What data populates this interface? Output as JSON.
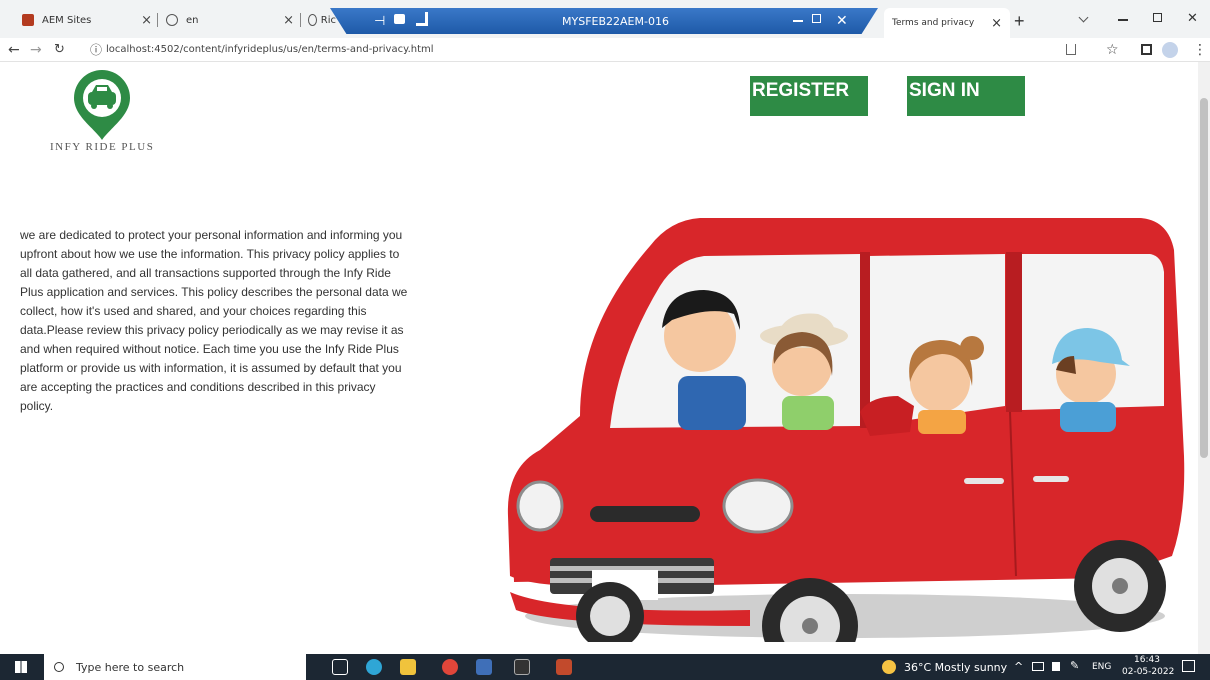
{
  "browser": {
    "tabs": [
      {
        "label": "AEM Sites"
      },
      {
        "label": "en"
      },
      {
        "label": "Ric"
      }
    ],
    "active_tab": {
      "label": "Terms and privacy"
    },
    "close_glyph": "×",
    "new_tab_glyph": "+",
    "remote_session": {
      "title": "MYSFEB22AEM-016"
    },
    "address": {
      "info_glyph": "ⓘ",
      "url": "localhost:4502/content/infyrideplus/us/en/terms-and-privacy.html"
    }
  },
  "header": {
    "register_label": "REGISTER",
    "signin_label": "SIGN IN",
    "logo_text": "INFY RIDE PLUS"
  },
  "policy_text": "we are dedicated to protect your personal information and informing you upfront about how we use the information. This privacy policy applies to all data gathered, and all transactions supported through the Infy Ride Plus application and services. This policy describes the personal data we collect, how it's used and shared, and your choices regarding this data.Please review this privacy policy periodically as we may revise it as and when required without notice. Each time you use the Infy Ride Plus platform or provide us with information, it is assumed by default that you are accepting the practices and conditions described in this privacy policy.",
  "taskbar": {
    "search_placeholder": "Type here to search",
    "weather": "36°C  Mostly sunny",
    "language": "ENG",
    "time": "16:43",
    "date": "02-05-2022"
  },
  "colors": {
    "brand_green": "#2e8b45",
    "car_red": "#d8262a"
  }
}
